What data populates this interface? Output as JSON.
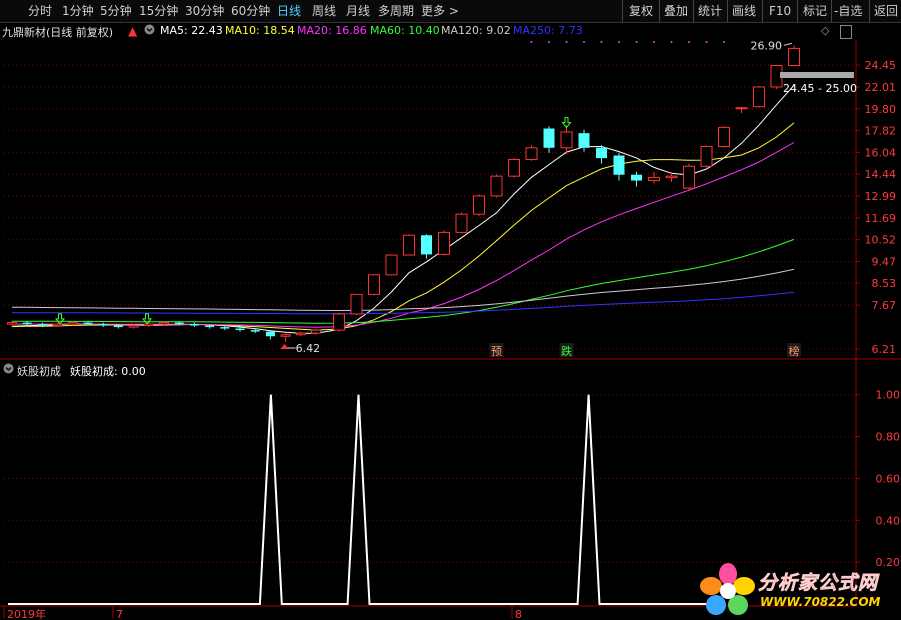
{
  "toolbar": {
    "periods": [
      "分时",
      "1分钟",
      "5分钟",
      "15分钟",
      "30分钟",
      "60分钟",
      "日线",
      "周线",
      "月线",
      "多周期",
      "更多 >"
    ],
    "active_period": "日线",
    "buttons": [
      "复权",
      "叠加",
      "统计",
      "画线",
      "F10",
      "标记",
      "-自选",
      "返回"
    ]
  },
  "header": {
    "title": "九鼎新材(日线 前复权)",
    "ma": [
      {
        "label": "MA5: 22.43",
        "color": "#ffffff"
      },
      {
        "label": "MA10: 18.54",
        "color": "#ffff33"
      },
      {
        "label": "MA20: 16.86",
        "color": "#ff33ff"
      },
      {
        "label": "MA60: 10.40",
        "color": "#33ff33"
      },
      {
        "label": "MA120: 9.02",
        "color": "#cccccc"
      },
      {
        "label": "MA250: 7.73",
        "color": "#3333ff"
      }
    ]
  },
  "indicator": {
    "name": "妖股初成",
    "value_label": "妖股初成: 0.00",
    "line_color": "#ffffff"
  },
  "annotations": {
    "high_price": "26.90",
    "low_price": "6.42",
    "range_box": "24.45 - 25.00",
    "marker_1": "预",
    "marker_2": "跌",
    "marker_3": "榜"
  },
  "x_axis": {
    "labels": [
      "2019年",
      "7",
      "8"
    ]
  },
  "watermark": {
    "line1": "分析家公式网",
    "line2": "WWW.70822.COM"
  },
  "colors": {
    "up": "#ff3333",
    "down": "#54ffff",
    "grid": "#8b0000"
  },
  "chart_data": [
    {
      "type": "candlestick",
      "title": "九鼎新材(日线 前复权)",
      "y_ticks": [
        24.45,
        22.01,
        19.8,
        17.82,
        16.04,
        14.44,
        12.99,
        11.69,
        10.52,
        9.47,
        8.53,
        7.67,
        6.21
      ],
      "ohlc": [
        [
          7.0,
          7.1,
          6.9,
          7.05
        ],
        [
          7.05,
          7.1,
          6.95,
          7.0
        ],
        [
          7.0,
          7.05,
          6.9,
          6.95
        ],
        [
          6.95,
          7.05,
          6.9,
          7.0
        ],
        [
          7.0,
          7.1,
          6.95,
          7.05
        ],
        [
          7.05,
          7.1,
          6.95,
          7.0
        ],
        [
          7.0,
          7.05,
          6.9,
          6.95
        ],
        [
          6.95,
          7.0,
          6.85,
          6.9
        ],
        [
          6.9,
          7.0,
          6.85,
          6.95
        ],
        [
          6.95,
          7.05,
          6.9,
          7.0
        ],
        [
          7.0,
          7.1,
          6.95,
          7.05
        ],
        [
          7.05,
          7.1,
          6.95,
          7.0
        ],
        [
          7.0,
          7.05,
          6.9,
          6.95
        ],
        [
          6.95,
          7.0,
          6.85,
          6.9
        ],
        [
          6.9,
          6.95,
          6.8,
          6.85
        ],
        [
          6.85,
          6.9,
          6.75,
          6.8
        ],
        [
          6.8,
          6.85,
          6.7,
          6.75
        ],
        [
          6.75,
          6.8,
          6.5,
          6.6
        ],
        [
          6.6,
          6.7,
          6.42,
          6.65
        ],
        [
          6.65,
          6.75,
          6.6,
          6.7
        ],
        [
          6.7,
          6.85,
          6.65,
          6.8
        ],
        [
          6.8,
          7.4,
          6.75,
          7.35
        ],
        [
          7.35,
          8.1,
          7.3,
          8.08
        ],
        [
          8.08,
          8.9,
          8.05,
          8.88
        ],
        [
          8.88,
          9.8,
          8.85,
          9.77
        ],
        [
          9.77,
          10.8,
          9.75,
          10.75
        ],
        [
          10.75,
          10.8,
          9.6,
          9.8
        ],
        [
          9.8,
          11.0,
          9.75,
          10.9
        ],
        [
          10.9,
          12.0,
          10.85,
          11.9
        ],
        [
          11.9,
          13.1,
          11.8,
          13.0
        ],
        [
          13.0,
          14.4,
          12.9,
          14.3
        ],
        [
          14.3,
          15.6,
          14.2,
          15.5
        ],
        [
          15.5,
          16.6,
          15.4,
          16.4
        ],
        [
          18.0,
          18.2,
          16.0,
          16.4
        ],
        [
          16.4,
          18.3,
          15.9,
          17.7
        ],
        [
          17.6,
          17.9,
          16.1,
          16.4
        ],
        [
          16.4,
          16.6,
          15.2,
          15.6
        ],
        [
          15.8,
          16.0,
          14.0,
          14.4
        ],
        [
          14.4,
          14.6,
          13.6,
          14.0
        ],
        [
          14.0,
          14.6,
          13.8,
          14.2
        ],
        [
          14.2,
          14.6,
          13.9,
          14.3
        ],
        [
          13.5,
          15.2,
          13.3,
          15.0
        ],
        [
          15.0,
          16.6,
          14.9,
          16.5
        ],
        [
          16.5,
          18.2,
          16.4,
          18.1
        ],
        [
          19.8,
          20.0,
          19.4,
          19.9
        ],
        [
          20.0,
          22.1,
          19.9,
          22.0
        ],
        [
          22.0,
          24.4,
          21.8,
          24.4
        ],
        [
          24.4,
          26.9,
          24.3,
          26.5
        ]
      ]
    },
    {
      "type": "line",
      "title": "妖股初成",
      "y_ticks": [
        1.0,
        0.8,
        0.6,
        0.4,
        0.2
      ],
      "ylim": [
        0,
        1.08
      ],
      "values": [
        0,
        0,
        0,
        0,
        0,
        0,
        0,
        0,
        0,
        0,
        0,
        0,
        0,
        0,
        0,
        0,
        0,
        0,
        0,
        0,
        0,
        0,
        0,
        0,
        1,
        0,
        0,
        0,
        0,
        0,
        0,
        0,
        1,
        0,
        0,
        0,
        0,
        0,
        0,
        0,
        0,
        0,
        0,
        0,
        0,
        0,
        0,
        0,
        0,
        0,
        0,
        0,
        0,
        1,
        0,
        0,
        0,
        0,
        0,
        0,
        0,
        0,
        0,
        0,
        0,
        0
      ]
    }
  ]
}
